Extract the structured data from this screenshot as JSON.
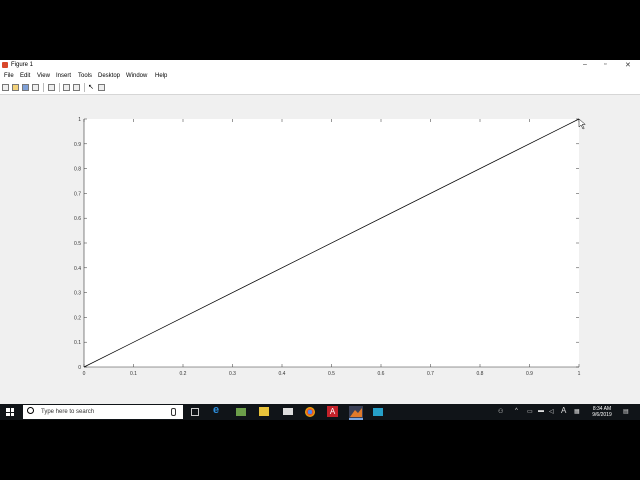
{
  "window": {
    "title": "Figure 1",
    "controls": {
      "minimize": "–",
      "maximize": "▫",
      "close": "✕"
    }
  },
  "menu": [
    "File",
    "Edit",
    "View",
    "Insert",
    "Tools",
    "Desktop",
    "Window",
    "Help"
  ],
  "toolbar_icons": [
    "new-figure-icon",
    "open-file-icon",
    "save-icon",
    "print-icon",
    "print-preview-icon",
    "link-plot-icon",
    "insert-colorbar-icon",
    "edit-plot-arrow-icon",
    "property-inspector-icon"
  ],
  "chart_data": {
    "type": "line",
    "x": [
      0,
      1
    ],
    "y": [
      0,
      1
    ],
    "xlim": [
      0,
      1
    ],
    "ylim": [
      0,
      1
    ],
    "xticks": [
      "0",
      "0.1",
      "0.2",
      "0.3",
      "0.4",
      "0.5",
      "0.6",
      "0.7",
      "0.8",
      "0.9",
      "1"
    ],
    "yticks": [
      "0",
      "0.1",
      "0.2",
      "0.3",
      "0.4",
      "0.5",
      "0.6",
      "0.7",
      "0.8",
      "0.9",
      "1"
    ],
    "title": "",
    "xlabel": "",
    "ylabel": "",
    "grid": false,
    "line_color": "#000000"
  },
  "taskbar": {
    "search_placeholder": "Type here to search",
    "pinned_icons": [
      "task-view-icon",
      "edge-icon",
      "photos-icon",
      "store-icon",
      "mail-icon",
      "chrome-icon",
      "acrobat-icon",
      "matlab-icon",
      "remote-desktop-icon"
    ],
    "tray_icons": [
      "people-icon",
      "chevron-up-icon",
      "network-icon",
      "battery-icon",
      "volume-icon",
      "ime-icon",
      "notification-icon"
    ],
    "tray_text": "A",
    "time": "8:34 AM",
    "date": "9/6/2019"
  },
  "colors": {
    "window_bg": "#f0f0f0",
    "axes_bg": "#ffffff",
    "taskbar_bg": "#101418"
  }
}
